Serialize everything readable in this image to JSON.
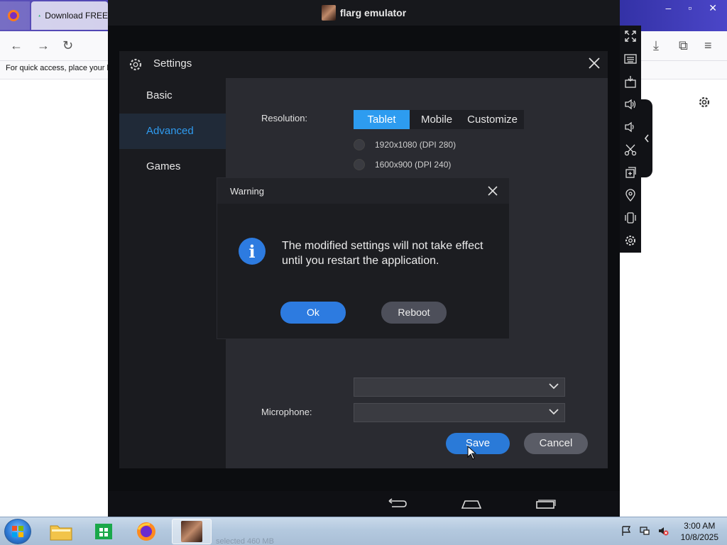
{
  "browser": {
    "tab_title": "Download FREE",
    "bookmarks_hint": "For quick access, place your b"
  },
  "emulator": {
    "title": "flarg emulator"
  },
  "settings": {
    "title": "Settings",
    "nav": [
      {
        "label": "Basic"
      },
      {
        "label": "Advanced"
      },
      {
        "label": "Games"
      }
    ],
    "resolution_label": "Resolution:",
    "resolution_tabs": [
      {
        "label": "Tablet"
      },
      {
        "label": "Mobile"
      },
      {
        "label": "Customize"
      }
    ],
    "resolutions": [
      {
        "label": "1920x1080 (DPI 280)"
      },
      {
        "label": "1600x900 (DPI 240)"
      }
    ],
    "microphone_label": "Microphone:",
    "save_label": "Save",
    "cancel_label": "Cancel"
  },
  "warning": {
    "title": "Warning",
    "icon": "info-icon",
    "message": "The modified settings will not take effect until you restart the application.",
    "ok_label": "Ok",
    "reboot_label": "Reboot"
  },
  "taskbar": {
    "behind_text": "selected  460 MB",
    "time": "3:00 AM",
    "date": "10/8/2025"
  },
  "colors": {
    "accent": "#2d9cf0",
    "active_nav_text": "#2f9bf0",
    "dialog_bg": "#1a1b1f",
    "panel_bg": "#2a2b31"
  }
}
